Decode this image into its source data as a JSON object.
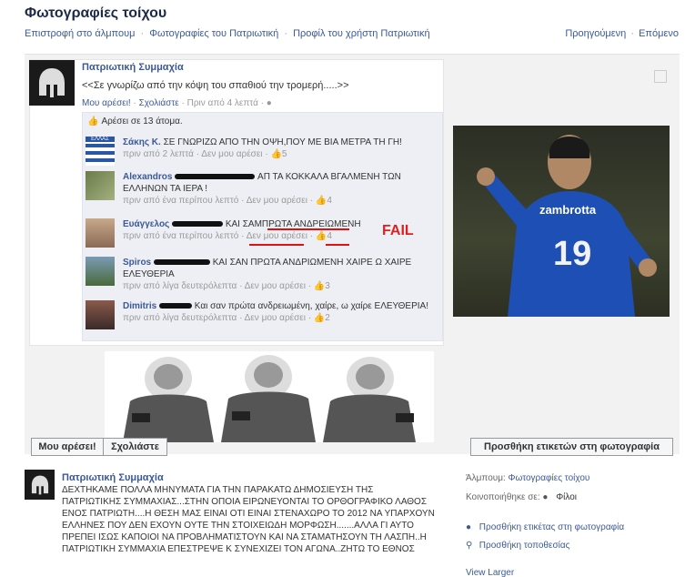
{
  "page": {
    "title": "Φωτογραφίες τοίχου"
  },
  "nav": {
    "back_album": "Επιστροφή στο άλμπουμ",
    "photos_of": "Φωτογραφίες του Πατριωτική",
    "profile_of": "Προφίλ του χρήστη Πατριωτική",
    "previous": "Προηγούμενη",
    "next": "Επόμενο",
    "separator": "·"
  },
  "embedded": {
    "author": "Πατριωτική Συμμαχία",
    "text": "<<Σε γνωρίζω από την κόψη του σπαθιού την τρομερή.....>>",
    "like_label": "Μου αρέσει!",
    "comment_label": "Σχολιάστε",
    "time": "Πριν από 4 λεπτά",
    "likes_text": "Αρέσει σε 13 άτομα.",
    "comments": [
      {
        "name": "Σάκης Κ.",
        "text": "ΣΕ ΓΝΩΡΙΖΩ ΑΠΟ ΤΗΝ ΟΨΗ,ΠΟΥ ΜΕ ΒΙΑ ΜΕΤΡΑ ΤΗ ΓΗ!",
        "time": "πριν από 2 λεπτά",
        "unlike": "Δεν μου αρέσει",
        "count": "5",
        "thumb_label": "ΕΛΛΑΣ"
      },
      {
        "name": "Alexandros",
        "text": "ΑΠ ΤΑ ΚΟΚΚΑΛΑ ΒΓΑΛΜΕΝΗ ΤΩΝ ΕΛΛΗΝΩΝ ΤΑ ΙΕΡΑ !",
        "time": "πριν από ένα περίπου λεπτό",
        "unlike": "Δεν μου αρέσει",
        "count": "4"
      },
      {
        "name": "Ευάγγελος",
        "text": "ΚΑΙ ΣΑΜΠΡΩΤΑ ΑΝΔΡΕΙΩΜΕΝΗ",
        "time": "πριν από ένα περίπου λεπτό",
        "unlike": "Δεν μου αρέσει",
        "count": "4"
      },
      {
        "name": "Spiros",
        "text": "ΚΑΙ ΣΑΝ ΠΡΩΤΑ ΑΝΔΡΙΩΜΕΝΗ ΧΑΙΡΕ Ω ΧΑΙΡΕ ΕΛΕΥΘΕΡΙΑ",
        "time": "πριν από λίγα δευτερόλεπτα",
        "unlike": "Δεν μου αρέσει",
        "count": "3"
      },
      {
        "name": "Dimitris",
        "text": "Και σαν πρώτα ανδρειωμένη, χαίρε, ω χαίρε ΕΛΕΥΘΕΡΙΑ!",
        "time": "πριν από λίγα δευτερόλεπτα",
        "unlike": "Δεν μου αρέσει",
        "count": "2"
      }
    ],
    "fail_label": "FAIL",
    "player_name": "zambrotta",
    "player_number": "19"
  },
  "actions": {
    "like": "Μου αρέσει!",
    "comment": "Σχολιάστε",
    "add_tag": "Προσθήκη ετικετών στη φωτογραφία"
  },
  "caption": {
    "author": "Πατριωτική Συμμαχία",
    "text": "ΔΕΧΤΗΚΑΜΕ ΠΟΛΛΑ ΜΗΝΥΜΑΤΑ ΓΙΑ ΤΗΝ ΠΑΡΑΚΑΤΩ ΔΗΜΟΣΙΕΥΣΗ ΤΗΣ ΠΑΤΡΙΩΤΙΚΗΣ ΣΥΜΜΑΧΙΑΣ...ΣΤΗΝ ΟΠΟΙΑ ΕΙΡΩΝΕΥΟΝΤΑΙ ΤΟ ΟΡΘΟΓΡΑΦΙΚΟ ΛΑΘΟΣ ΕΝΟΣ ΠΑΤΡΙΩΤΗ....Η ΘΕΣΗ ΜΑΣ ΕΙΝΑΙ ΟΤΙ ΕΙΝΑΙ ΣΤΕΝΑΧΩΡΟ ΤΟ 2012 ΝΑ ΥΠΑΡΧΟΥΝ ΕΛΛΗΝΕΣ ΠΟΥ ΔΕΝ ΕΧΟΥΝ ΟΥΤΕ ΤΗΝ ΣΤΟΙΧΕΙΩΔΗ ΜΟΡΦΩΣΗ.......ΑΛΛΑ ΓΙ ΑΥΤΟ ΠΡΕΠΕΙ ΙΣΩΣ ΚΑΠΟΙΟΙ ΝΑ ΠΡΟΒΛΗΜΑΤΙΣΤΟΥΝ ΚΑΙ ΝΑ ΣΤΑΜΑΤΗΣΟΥΝ ΤΗ ΛΑΣΠΗ..Η ΠΑΤΡΙΩΤΙΚΗ ΣΥΜΜΑΧΙΑ ΕΠΕΣΤΡΕΨΕ Κ ΣΥΝΕΧΙΖΕΙ ΤΟΝ ΑΓΩΝΑ..ΖΗΤΩ ΤΟ ΕΘΝΟΣ"
  },
  "sidebar": {
    "album_label": "Άλμπουμ:",
    "album_value": "Φωτογραφίες τοίχου",
    "shared_label": "Κοινοποιήθηκε σε:",
    "shared_value": "Φίλοι",
    "tag_photo": "Προσθήκη ετικέτας στη φωτογραφία",
    "add_location": "Προσθήκη τοποθεσίας",
    "view_larger": "View Larger"
  },
  "colors": {
    "link": "#3b5998",
    "fail": "#e02020"
  }
}
